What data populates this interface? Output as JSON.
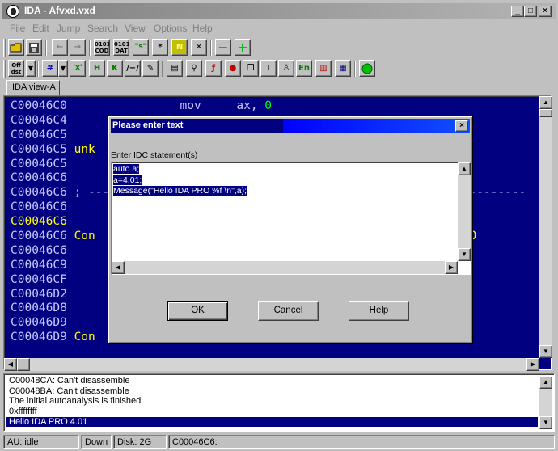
{
  "window": {
    "title": "IDA - Afvxd.vxd",
    "minimize": "_",
    "maximize": "□",
    "close": "×"
  },
  "menu": [
    "File",
    "Edit",
    "Jump",
    "Search",
    "View",
    "Options",
    "Help"
  ],
  "toolbar1": {
    "code_label": "0101\nCOD",
    "data_label": "0101\nDAT",
    "string_label": "\"s\"",
    "star_label": "*",
    "n_label": "N",
    "x_label": "✕",
    "minus_label": "−",
    "plus_label": "+"
  },
  "toolbar2": {
    "offset_label": "Off\ndst",
    "x_label": "'x'",
    "h_label": "H",
    "k_label": "K",
    "en_label": "En"
  },
  "tabs": [
    "IDA view-A"
  ],
  "disasm": {
    "lines": [
      {
        "addr": "C00046C0",
        "text": "                mov     ax, ",
        "num": "0",
        "highlight": false
      },
      {
        "addr": "C00046C4",
        "text": "",
        "num": "",
        "highlight": false
      },
      {
        "addr": "C00046C5",
        "text": "",
        "num": "",
        "highlight": false
      },
      {
        "addr": "C00046C5",
        "text": " unk",
        "num": "",
        "highlight": false
      },
      {
        "addr": "C00046C5",
        "text": "",
        "num": "",
        "highlight": false
      },
      {
        "addr": "C00046C6",
        "text": "",
        "num": "",
        "highlight": false
      },
      {
        "addr": "C00046C6",
        "text": " ; --------------------------------------------------------------",
        "num": "",
        "highlight": false
      },
      {
        "addr": "C00046C6",
        "text": "",
        "num": "",
        "highlight": false
      },
      {
        "addr": "C00046C6",
        "text": "",
        "num": "",
        "highlight": true
      },
      {
        "addr": "C00046C6",
        "text": " Con                                              REF: LCO",
        "num": "",
        "highlight": false
      },
      {
        "addr": "C00046C6",
        "text": "",
        "num": "",
        "highlight": false
      },
      {
        "addr": "C00046C9",
        "text": "",
        "num": "",
        "highlight": false
      },
      {
        "addr": "C00046CF",
        "text": "",
        "num": "",
        "highlight": false
      },
      {
        "addr": "C00046D2",
        "text": "",
        "num": "",
        "highlight": false
      },
      {
        "addr": "C00046D8",
        "text": "",
        "num": "",
        "highlight": false
      },
      {
        "addr": "C00046D9",
        "text": "",
        "num": "",
        "highlight": false
      },
      {
        "addr": "C00046D9",
        "text": " Con",
        "num": "",
        "highlight": false
      }
    ]
  },
  "dialog": {
    "title": "Please enter text",
    "close": "×",
    "label": "Enter IDC statement(s)",
    "lines": [
      "auto a;",
      "a=4.01;",
      "Message(\"Hello IDA PRO %f \\n\",a);"
    ],
    "ok": "OK",
    "cancel": "Cancel",
    "help": "Help"
  },
  "messages": [
    "C00048CA: Can't disassemble",
    "C00048BA: Can't disassemble",
    "The initial autoanalysis is finished.",
    "0xffffffff",
    "Hello IDA PRO 4.01"
  ],
  "status": {
    "au": "AU:  idle",
    "direction": "Down",
    "disk": "Disk: 2G",
    "address": "C00046C6:"
  },
  "colors": {
    "disasm_bg": "#000080",
    "address_hl": "#ffff00",
    "accent": "#000080"
  }
}
